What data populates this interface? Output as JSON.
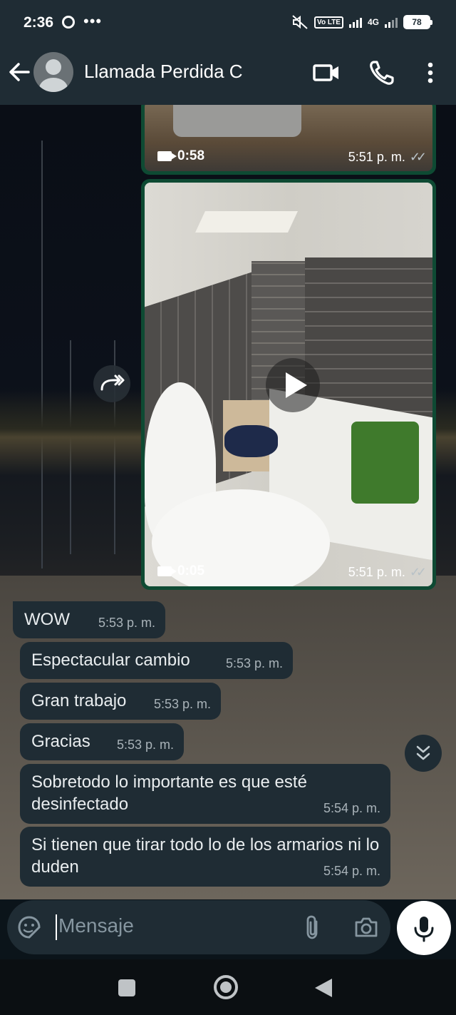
{
  "status_bar": {
    "time": "2:36",
    "more": "•••",
    "volte": "Vo LTE",
    "network": "4G",
    "battery": "78"
  },
  "header": {
    "contact_name": "Llamada Perdida C"
  },
  "messages": {
    "video1": {
      "duration": "0:58",
      "time": "5:51 p. m."
    },
    "video2": {
      "duration": "0:05",
      "time": "5:51 p. m."
    },
    "texts": [
      {
        "text": "WOW",
        "time": "5:53 p. m."
      },
      {
        "text": "Espectacular cambio",
        "time": "5:53 p. m."
      },
      {
        "text": "Gran trabajo",
        "time": "5:53 p. m."
      },
      {
        "text": "Gracias",
        "time": "5:53 p. m."
      },
      {
        "text": "Sobretodo lo importante es que esté desinfectado",
        "time": "5:54 p. m."
      },
      {
        "text": "Si tienen que tirar todo lo de los armarios ni lo duden",
        "time": "5:54 p. m."
      }
    ]
  },
  "composer": {
    "placeholder": "Mensaje"
  },
  "colors": {
    "header_bg": "#1f2c34",
    "bubble_bg": "#1f2c34",
    "video_border": "#0e4a33",
    "text": "#e9edef",
    "meta_text": "#a9b3b9"
  }
}
